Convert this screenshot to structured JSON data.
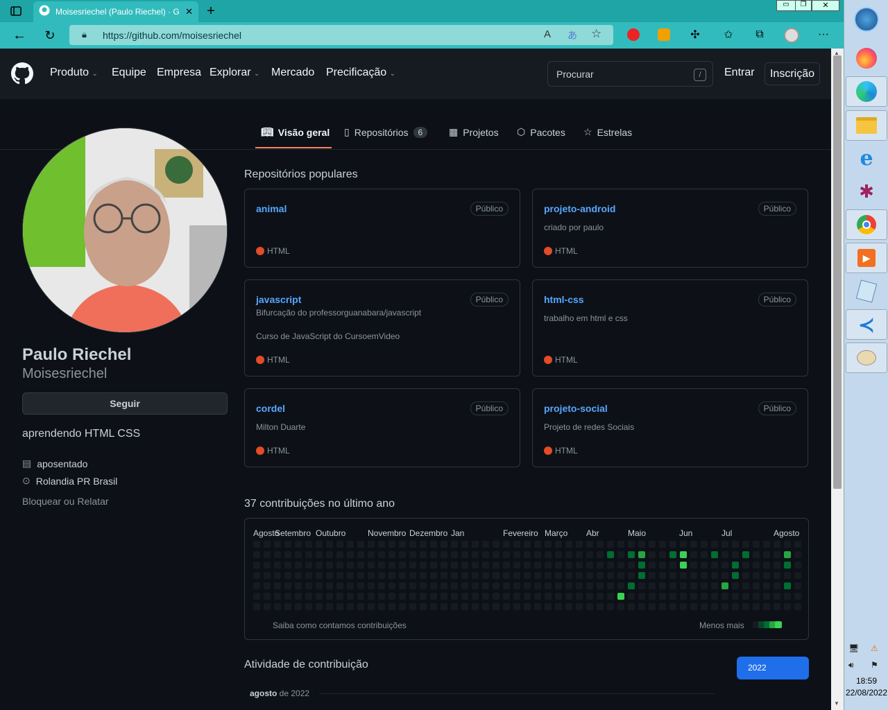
{
  "browser": {
    "tab_title": "Moisesriechel (Paulo Riechel) · G",
    "url": "https://github.com/moisesriechel",
    "read_aloud_label": "A",
    "translate_label": "あ",
    "new_tab_label": "+",
    "close_tab_label": "✕",
    "more_label": "···",
    "window_controls": {
      "minimize": "▭",
      "restore": "❐",
      "close": "✕"
    },
    "icons": [
      "tab-actions-icon",
      "github-favicon",
      "back-icon",
      "refresh-icon",
      "lock-icon",
      "read-aloud-icon",
      "translate-icon",
      "favorite-add-icon",
      "adblock-icon",
      "extension-icon",
      "puzzle-icon",
      "favorites-icon",
      "collections-icon",
      "profile-icon",
      "more-icon"
    ]
  },
  "github": {
    "nav": [
      "Produto",
      "Equipe",
      "Empresa",
      "Explorar",
      "Mercado",
      "Precificação"
    ],
    "search_placeholder": "Procurar",
    "search_shortcut": "/",
    "signin": "Entrar",
    "signup": "Inscrição"
  },
  "profile_tabs": [
    {
      "label": "Visão geral",
      "icon": "book-icon"
    },
    {
      "label": "Repositórios",
      "icon": "repo-icon",
      "count": "6"
    },
    {
      "label": "Projetos",
      "icon": "table-icon"
    },
    {
      "label": "Pacotes",
      "icon": "package-icon"
    },
    {
      "label": "Estrelas",
      "icon": "star-icon"
    }
  ],
  "profile": {
    "name": "Paulo Riechel",
    "username": "Moisesriechel",
    "follow": "Seguir",
    "bio": "aprendendo HTML CSS",
    "company": "aposentado",
    "location": "Rolandia PR Brasil",
    "block": "Bloquear ou Relatar"
  },
  "popular": {
    "heading": "Repositórios populares",
    "repos": [
      {
        "name": "animal",
        "badge": "Público",
        "desc": "",
        "desc2": "",
        "lang": "HTML"
      },
      {
        "name": "projeto-android",
        "badge": "Público",
        "desc": "criado por paulo",
        "desc2": "",
        "lang": "HTML"
      },
      {
        "name": "javascript",
        "badge": "Público",
        "desc": "Bifurcação do professorguanabara/javascript",
        "desc2": "Curso de JavaScript do CursoemVideo",
        "lang": "HTML"
      },
      {
        "name": "html-css",
        "badge": "Público",
        "desc": "trabalho em html e css",
        "desc2": "",
        "lang": "HTML"
      },
      {
        "name": "cordel",
        "badge": "Público",
        "desc": "Milton Duarte",
        "desc2": "",
        "lang": "HTML"
      },
      {
        "name": "projeto-social",
        "badge": "Público",
        "desc": "Projeto de redes Sociais",
        "desc2": "",
        "lang": "HTML"
      }
    ],
    "lang_color": "#e34c26"
  },
  "contributions": {
    "heading": "37 contribuições no último ano",
    "months": [
      "Agosto",
      "Setembro",
      "Outubro",
      "Novembro",
      "Dezembro",
      "Jan",
      "Fevereiro",
      "Março",
      "Abr",
      "Maio",
      "Jun",
      "Jul",
      "Agosto"
    ],
    "learn": "Saiba como contamos contribuições",
    "legend": "Menos mais",
    "levels": [
      "#161b22",
      "#0e4429",
      "#006d32",
      "#26a641",
      "#39d353"
    ],
    "active_cells": [
      [
        34,
        1,
        2
      ],
      [
        36,
        1,
        2
      ],
      [
        37,
        1,
        3
      ],
      [
        40,
        1,
        2
      ],
      [
        41,
        1,
        4
      ],
      [
        44,
        1,
        2
      ],
      [
        47,
        1,
        2
      ],
      [
        51,
        1,
        3
      ],
      [
        37,
        2,
        2
      ],
      [
        41,
        2,
        4
      ],
      [
        46,
        2,
        2
      ],
      [
        51,
        2,
        2
      ],
      [
        37,
        3,
        2
      ],
      [
        46,
        3,
        2
      ],
      [
        36,
        4,
        2
      ],
      [
        45,
        4,
        3
      ],
      [
        51,
        4,
        2
      ],
      [
        35,
        5,
        4
      ]
    ]
  },
  "activity": {
    "heading": "Atividade de contribuição",
    "year": "2022",
    "month_bold": "agosto",
    "month_rest": " de 2022"
  },
  "taskbar": {
    "time": "18:59",
    "date": "22/08/2022",
    "apps": [
      "windows-start-icon",
      "firefox-icon",
      "edge-icon",
      "file-explorer-icon",
      "internet-explorer-icon",
      "spider-icon",
      "chrome-icon",
      "media-player-icon",
      "notepad-icon",
      "vscode-icon",
      "paint-icon"
    ]
  }
}
